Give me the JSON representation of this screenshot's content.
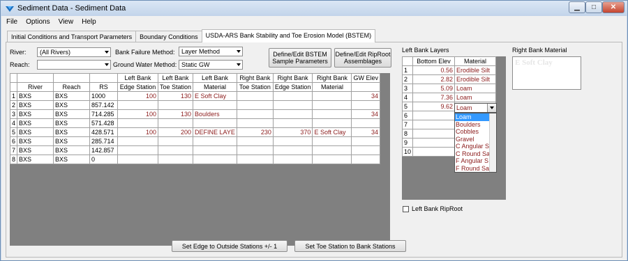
{
  "window": {
    "title": "Sediment Data - Sediment Data",
    "min_label": "▁",
    "max_label": "□",
    "close_label": "✕"
  },
  "menu": [
    "File",
    "Options",
    "View",
    "Help"
  ],
  "tabs": [
    "Initial Conditions and Transport Parameters",
    "Boundary Conditions",
    "USDA-ARS Bank Stability and Toe Erosion Model (BSTEM)"
  ],
  "controls": {
    "river_label": "River:",
    "river_value": "(All Rivers)",
    "reach_label": "Reach:",
    "reach_value": "",
    "bank_failure_label": "Bank Failure Method:",
    "bank_failure_value": "Layer Method",
    "gw_label": "Ground Water Method:",
    "gw_value": "Static GW",
    "define_bstem_label": "Define/Edit BSTEM Sample Parameters",
    "define_riproot_label": "Define/Edit RipRoot Assemblages"
  },
  "main_table": {
    "header_top": [
      "",
      "",
      "",
      "Left Bank",
      "Left Bank",
      "Left Bank",
      "Right Bank",
      "Right Bank",
      "Right Bank",
      "GW Elev"
    ],
    "header_bottom": [
      "River",
      "Reach",
      "RS",
      "Edge Station",
      "Toe Station",
      "Material",
      "Toe Station",
      "Edge Station",
      "Material",
      ""
    ],
    "rows": [
      [
        "1",
        "BXS",
        "BXS",
        "1000",
        "100",
        "130",
        "E Soft Clay",
        "",
        "",
        "",
        "34"
      ],
      [
        "2",
        "BXS",
        "BXS",
        "857.142",
        "",
        "",
        "",
        "",
        "",
        "",
        ""
      ],
      [
        "3",
        "BXS",
        "BXS",
        "714.285",
        "100",
        "130",
        "Boulders",
        "",
        "",
        "",
        "34"
      ],
      [
        "4",
        "BXS",
        "BXS",
        "571.428",
        "",
        "",
        "",
        "",
        "",
        "",
        ""
      ],
      [
        "5",
        "BXS",
        "BXS",
        "428.571",
        "100",
        "200",
        "DEFINE LAYE",
        "230",
        "370",
        "E Soft Clay",
        "34"
      ],
      [
        "6",
        "BXS",
        "BXS",
        "285.714",
        "",
        "",
        "",
        "",
        "",
        "",
        ""
      ],
      [
        "7",
        "BXS",
        "BXS",
        "142.857",
        "",
        "",
        "",
        "",
        "",
        "",
        ""
      ],
      [
        "8",
        "BXS",
        "BXS",
        "0",
        "",
        "",
        "",
        "",
        "",
        "",
        ""
      ]
    ]
  },
  "left_bank": {
    "title": "Left Bank Layers",
    "headers": [
      "Bottom Elev",
      "Material"
    ],
    "rows": [
      [
        "1",
        "0.56",
        "Erodible Silt"
      ],
      [
        "2",
        "2.82",
        "Erodible Silt"
      ],
      [
        "3",
        "5.09",
        "Loam"
      ],
      [
        "4",
        "7.36",
        "Loam"
      ],
      [
        "5",
        "9.62",
        "Loam"
      ],
      [
        "6",
        "",
        ""
      ],
      [
        "7",
        "",
        ""
      ],
      [
        "8",
        "",
        ""
      ],
      [
        "9",
        "",
        ""
      ],
      [
        "10",
        "",
        ""
      ]
    ],
    "dropdown_value": "Loam",
    "options": [
      "Loam",
      "Boulders",
      "Cobbles",
      "Gravel",
      "C Angular S",
      "C Round Sa",
      "F Angular S",
      "F Round Sa"
    ],
    "riproot_label": "Left Bank RipRoot"
  },
  "right_bank": {
    "title": "Right Bank Material",
    "value": "E Soft Clay"
  },
  "bottom_buttons": {
    "set_edge": "Set Edge to Outside Stations +/- 1",
    "set_toe": "Set Toe Station to Bank Stations"
  }
}
